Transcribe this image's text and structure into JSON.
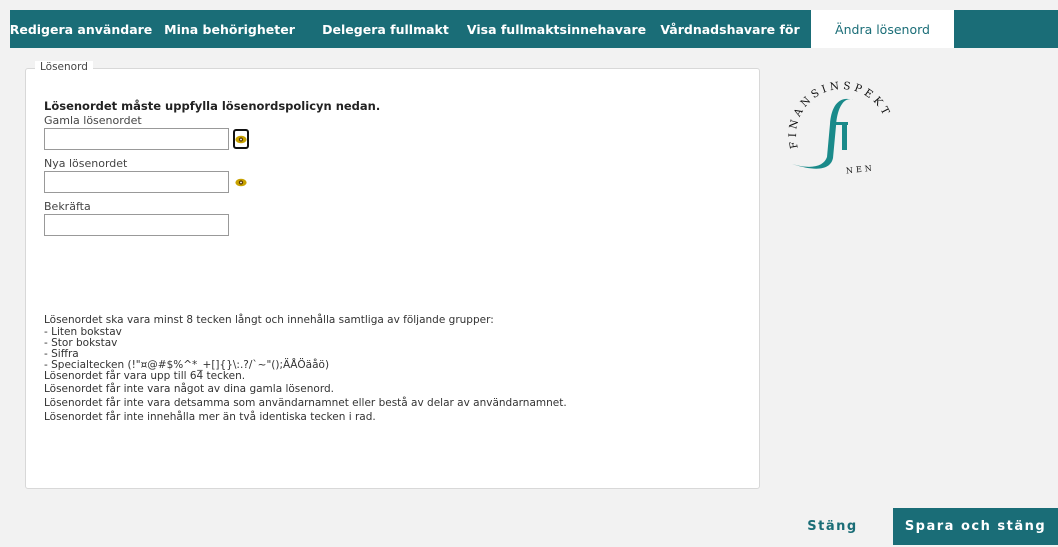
{
  "tabs": [
    {
      "label": "Redigera användare"
    },
    {
      "label": "Mina behörigheter"
    },
    {
      "label": "Delegera fullmakt"
    },
    {
      "label": "Visa fullmaktsinnehavare"
    },
    {
      "label": "Vårdnadshavare för"
    },
    {
      "label": "Ändra lösenord",
      "active": true
    }
  ],
  "panel": {
    "legend": "Lösenord",
    "policy_title": "Lösenordet måste uppfylla lösenordspolicyn nedan.",
    "fields": {
      "old": {
        "label": "Gamla lösenordet",
        "value": ""
      },
      "new": {
        "label": "Nya lösenordet",
        "value": ""
      },
      "confirm": {
        "label": "Bekräfta",
        "value": ""
      }
    },
    "rules": {
      "intro": "Lösenordet ska vara minst 8 tecken långt och innehålla samtliga av följande grupper:",
      "groups": [
        "- Liten bokstav",
        "- Stor bokstav",
        "- Siffra",
        "- Specialtecken (!\"¤@#$%^*_+[]{}\\:.?/`~\"();ÄÅÖäåö)"
      ],
      "lines": [
        "Lösenordet får vara upp till 64 tecken.",
        "Lösenordet får inte vara något av dina gamla lösenord.",
        "Lösenordet får inte vara detsamma som användarnamnet eller bestå av delar av användarnamnet.",
        "Lösenordet får inte innehålla mer än två identiska tecken i rad."
      ]
    }
  },
  "logo": {
    "text": "FINANSINSPEKTIONEN",
    "icon": "fi-logo",
    "color": "#1a8a8a"
  },
  "buttons": {
    "close": "Stäng",
    "save": "Spara och stäng"
  },
  "colors": {
    "brand": "#1a6d77",
    "accent_eye": "#c8a200"
  }
}
